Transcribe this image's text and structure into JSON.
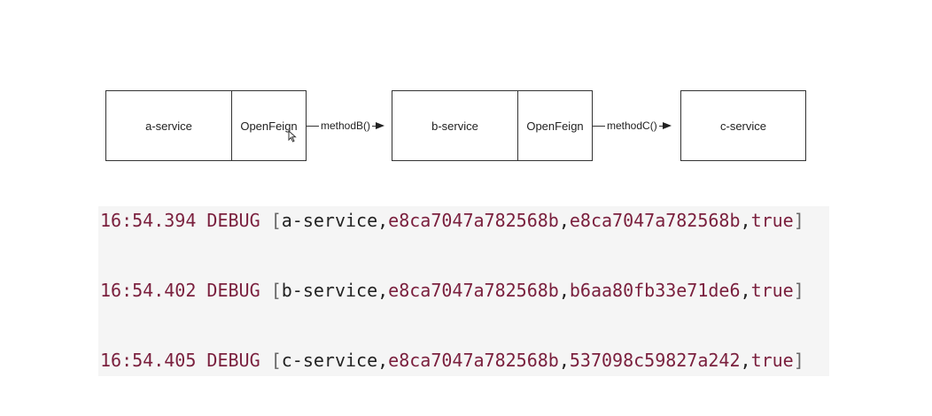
{
  "diagram": {
    "nodes": {
      "a_service": "a-service",
      "a_openfeign": "OpenFeign",
      "b_service": "b-service",
      "b_openfeign": "OpenFeign",
      "c_service": "c-service"
    },
    "edges": {
      "ab": "methodB()",
      "bc": "methodC()"
    }
  },
  "logs": [
    {
      "time": "16:54.394",
      "level": "DEBUG",
      "service": "a-service",
      "trace_id": "e8ca7047a782568b",
      "span_id": "e8ca7047a782568b",
      "exportable": "true"
    },
    {
      "time": "16:54.402",
      "level": "DEBUG",
      "service": "b-service",
      "trace_id": "e8ca7047a782568b",
      "span_id": "b6aa80fb33e71de6",
      "exportable": "true"
    },
    {
      "time": "16:54.405",
      "level": "DEBUG",
      "service": "c-service",
      "trace_id": "e8ca7047a782568b",
      "span_id": "537098c59827a242",
      "exportable": "true"
    }
  ],
  "colors": {
    "keyword": "#7a1f3d",
    "panel_bg": "#f5f5f5",
    "border": "#333333"
  },
  "icons": [
    "mouse-cursor-icon",
    "arrowhead-icon"
  ]
}
